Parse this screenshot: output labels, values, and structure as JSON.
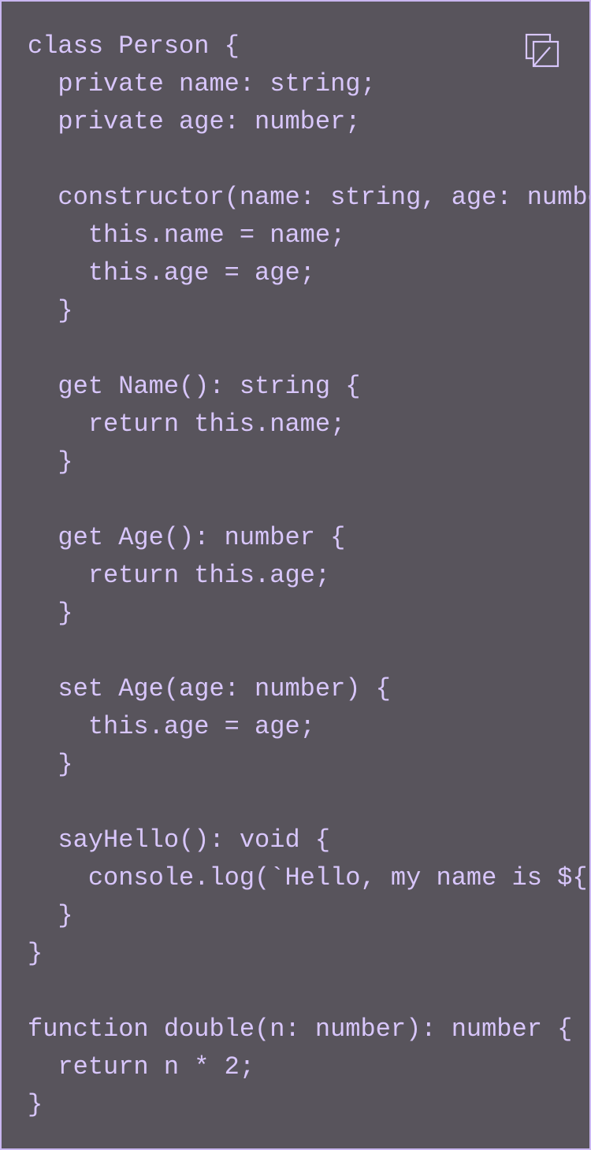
{
  "code": {
    "lines": [
      "class Person {",
      "  private name: string;",
      "  private age: number;",
      "",
      "  constructor(name: string, age: number) {",
      "    this.name = name;",
      "    this.age = age;",
      "  }",
      "",
      "  get Name(): string {",
      "    return this.name;",
      "  }",
      "",
      "  get Age(): number {",
      "    return this.age;",
      "  }",
      "",
      "  set Age(age: number) {",
      "    this.age = age;",
      "  }",
      "",
      "  sayHello(): void {",
      "    console.log(`Hello, my name is ${this.name}`);",
      "  }",
      "}",
      "",
      "function double(n: number): number {",
      "  return n * 2;",
      "}"
    ]
  },
  "copy_button": {
    "icon": "copy-icon"
  },
  "colors": {
    "background": "#58545c",
    "text": "#d8c6fb",
    "border": "#c9b6f0"
  }
}
